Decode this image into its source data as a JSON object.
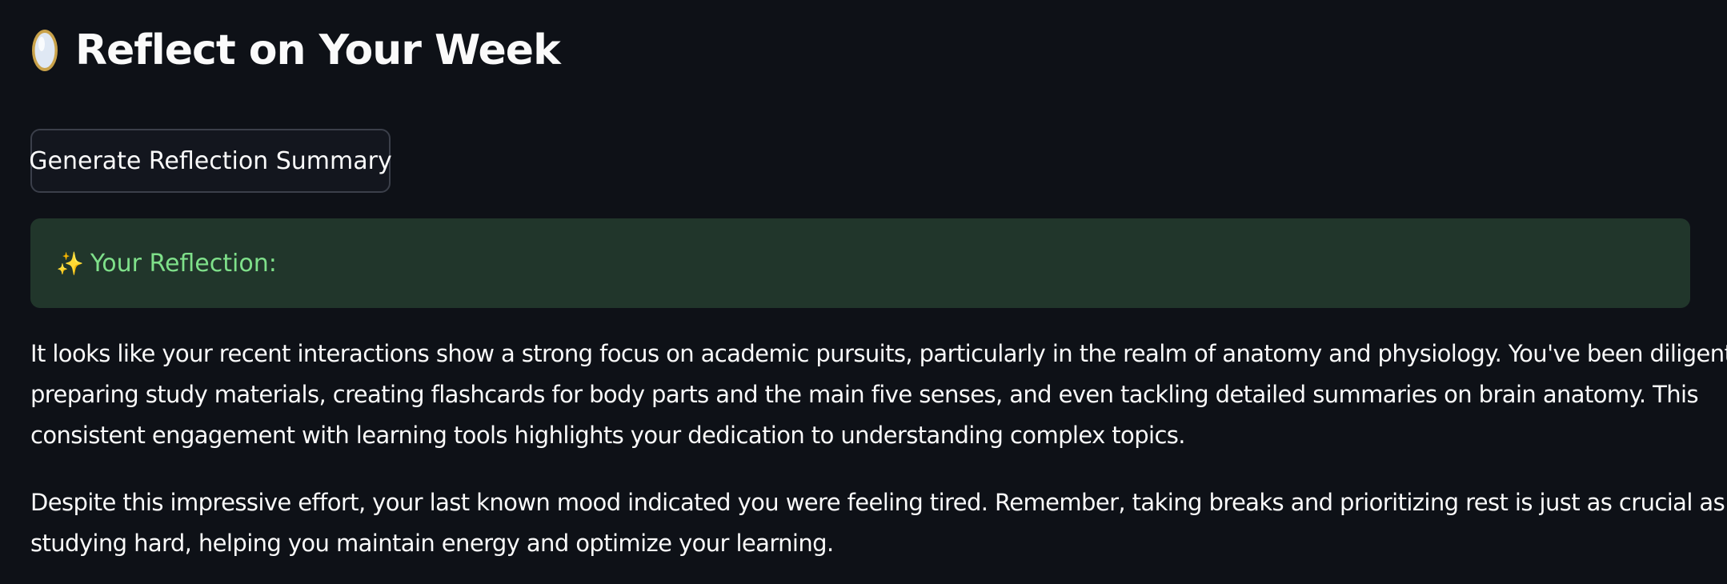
{
  "header": {
    "icon": "mirror-icon",
    "title": "Reflect on Your Week"
  },
  "actions": {
    "generate_label": "Generate Reflection Summary"
  },
  "reflection": {
    "heading_icon": "sparkles-icon",
    "heading": "Your Reflection:",
    "paragraph_1": [
      "It looks like your recent interactions show a strong focus on academic pursuits, particularly in the realm of anatomy and physiology. You've been diligently",
      "preparing study materials, creating flashcards for body parts and the main five senses, and even tackling detailed summaries on brain anatomy. This",
      "consistent engagement with learning tools highlights your dedication to understanding complex topics."
    ],
    "paragraph_2": [
      "Despite this impressive effort, your last known mood indicated you were feeling tired. Remember, taking breaks and prioritizing rest is just as crucial as",
      "studying hard, helping you maintain energy and optimize your learning."
    ]
  },
  "colors": {
    "background": "#0e1117",
    "success_bg": "#21362b",
    "success_text": "#7fe08a"
  }
}
